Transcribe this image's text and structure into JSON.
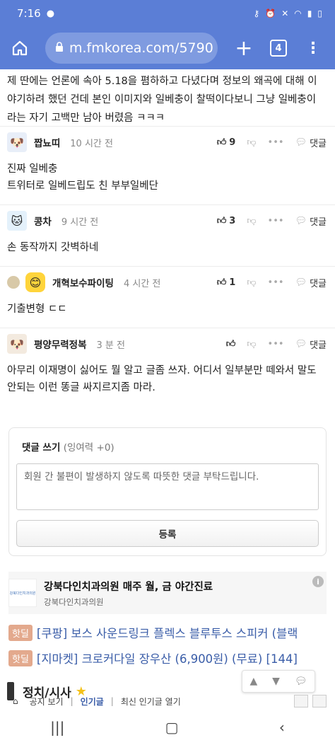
{
  "status": {
    "time": "7:16"
  },
  "browser": {
    "url": "m.fmkorea.com/5790",
    "tab_count": "4"
  },
  "post_tail": "제 딴에는 언론에 속아 5.18을 폄하하고 다녔다며 정보의 왜곡에 대해 이야기하려 했던 건데 본인 이미지와 일베충이 찰떡이다보니 그냥 일베충이라는 자기 고백만 남아 버렸음 ㅋㅋㅋ",
  "comments": [
    {
      "name": "짭뇨띠",
      "time": "10 시간 전",
      "likes": "9",
      "reply": "댓글",
      "body": "진짜 일베충\n트위터로 일베드립도 친 부부일베단"
    },
    {
      "name": "콩차",
      "time": "9 시간 전",
      "likes": "3",
      "reply": "댓글",
      "body": "손 동작까지 갓벽하네"
    },
    {
      "name": "개혁보수파이팅",
      "time": "4 시간 전",
      "likes": "1",
      "reply": "댓글",
      "body": "기출변형 ㄷㄷ"
    },
    {
      "name": "평양무력정복",
      "time": "3 분 전",
      "likes": "",
      "reply": "댓글",
      "body": "아무리 이재명이 싫어도 뭘 알고 글좀 쓰자. 어디서 일부분만 떼와서 말도 안되는 이런 똥글 싸지르지좀 마라."
    }
  ],
  "write": {
    "title": "댓글 쓰기",
    "surplus": "(잉여력 +0)",
    "placeholder": "회원 간 불편이 발생하지 않도록 따뜻한 댓글 부탁드립니다.",
    "submit": "등록"
  },
  "ad": {
    "title": "강북다인치과의원 매주 월, 금 야간진료",
    "sub": "강북다인치과의원",
    "logo_text": "강북다인치과의원"
  },
  "hot_deals": [
    {
      "badge": "핫딜",
      "text": "[쿠팡] 보스 사운드링크 플렉스 블루투스 스피커 (블랙"
    },
    {
      "badge": "핫딜",
      "text": "[지마켓] 크로커다일 장우산 (6,900원) (무료) [144]"
    }
  ],
  "section": {
    "title": "정치/시사"
  },
  "bottom_tabs": {
    "notice": "공지 보기",
    "popular": "인기글",
    "recent": "최신 인기글 열기"
  }
}
